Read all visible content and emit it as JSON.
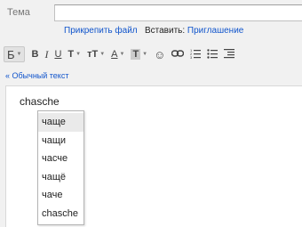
{
  "compose": {
    "subject_label": "Тема",
    "subject_value": "",
    "attach_link": "Прикрепить файл",
    "insert_label": "Вставить:",
    "invitation_link": "Приглашение"
  },
  "toolbar": {
    "font_label": "Б",
    "bold_label": "B",
    "italic_label": "I",
    "underline_label": "U",
    "text_color_label": "T",
    "font_size_label": "тT",
    "underline_color_label": "A",
    "highlight_label": "T",
    "emoji_label": "☺",
    "link_label": "⚯",
    "numbered_list_label": "⅓",
    "bullet_list_label": "⁝≡",
    "indent_label": "≡"
  },
  "plain_text_link": "« Обычный текст",
  "editor": {
    "text": "chasche"
  },
  "suggestions": [
    "чаще",
    "чащи",
    "часче",
    "чащё",
    "чаче",
    "chasche"
  ],
  "selected_suggestion_index": 0
}
